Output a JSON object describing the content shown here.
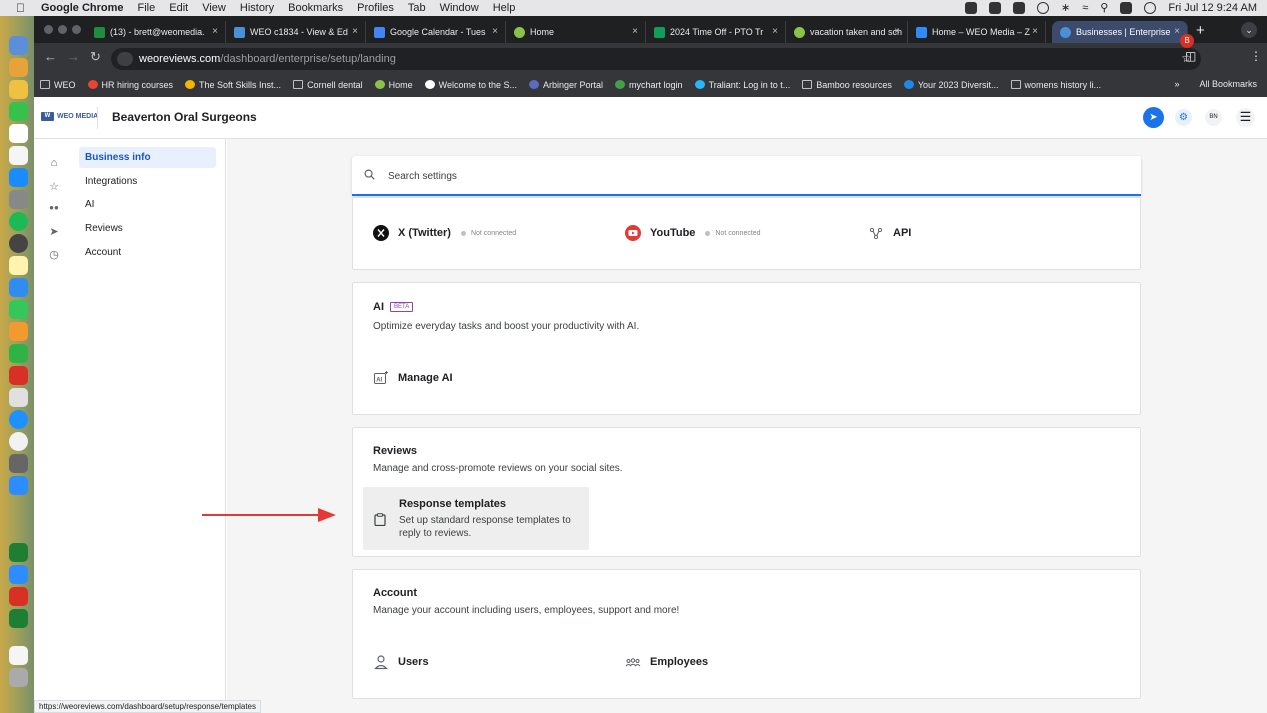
{
  "menubar": {
    "app": "Google Chrome",
    "items": [
      "File",
      "Edit",
      "View",
      "History",
      "Bookmarks",
      "Profiles",
      "Tab",
      "Window",
      "Help"
    ],
    "clock": "Fri Jul 12  9:24 AM"
  },
  "tabs": [
    {
      "label": "(13) - brett@weomedia.",
      "color": "#1e8e3e"
    },
    {
      "label": "WEO c1834 - View & Ed",
      "color": "#4a90d9"
    },
    {
      "label": "Google Calendar - Tues",
      "color": "#4285f4"
    },
    {
      "label": "Home",
      "color": "#8bc34a"
    },
    {
      "label": "2024 Time Off - PTO Tr",
      "color": "#0f9d58"
    },
    {
      "label": "vacation taken and sch",
      "color": "#8bc34a"
    },
    {
      "label": "Home – WEO Media – Z",
      "color": "#2d8cff"
    },
    {
      "label": "Businesses | Enterprise",
      "color": "#4a90d9"
    }
  ],
  "omnibox": {
    "host": "weoreviews.com",
    "path": "/dashboard/enterprise/setup/landing"
  },
  "profile_initial": "B",
  "bookmarks": [
    {
      "label": "WEO",
      "type": "folder"
    },
    {
      "label": "HR hiring courses",
      "type": "site",
      "color": "#ea4335"
    },
    {
      "label": "The Soft Skills Inst...",
      "type": "site",
      "color": "#f4b400"
    },
    {
      "label": "Cornell dental",
      "type": "folder"
    },
    {
      "label": "Home",
      "type": "site",
      "color": "#8bc34a"
    },
    {
      "label": "Welcome to the S...",
      "type": "site",
      "color": "#ffffff"
    },
    {
      "label": "Arbinger Portal",
      "type": "site",
      "color": "#5c6bc0"
    },
    {
      "label": "mychart login",
      "type": "site",
      "color": "#43a047"
    },
    {
      "label": "Traliant: Log in to t...",
      "type": "site",
      "color": "#29b6f6"
    },
    {
      "label": "Bamboo resources",
      "type": "folder"
    },
    {
      "label": "Your 2023 Diversit...",
      "type": "site",
      "color": "#1e88e5"
    },
    {
      "label": "womens history li...",
      "type": "folder"
    }
  ],
  "bookmarks_overflow": "»",
  "bookmarks_all": "All Bookmarks",
  "app": {
    "logo_text": "WEO MEDIA",
    "business_name": "Beaverton Oral Surgeons",
    "user_initials": "BN"
  },
  "sidenav": {
    "items": [
      "Business info",
      "Integrations",
      "AI",
      "Reviews",
      "Account"
    ]
  },
  "search": {
    "placeholder": "Search settings"
  },
  "social": {
    "twitter": {
      "label": "X (Twitter)",
      "status": "Not connected"
    },
    "youtube": {
      "label": "YouTube",
      "status": "Not connected"
    },
    "api": {
      "label": "API"
    }
  },
  "ai_card": {
    "title": "AI",
    "badge": "BETA",
    "desc": "Optimize everyday tasks and boost your productivity with AI.",
    "item": "Manage AI"
  },
  "reviews_card": {
    "title": "Reviews",
    "desc": "Manage and cross-promote reviews on your social sites.",
    "item_title": "Response templates",
    "item_desc": "Set up standard response templates to reply to reviews."
  },
  "account_card": {
    "title": "Account",
    "desc": "Manage your account including users, employees, support and more!",
    "users": "Users",
    "employees": "Employees"
  },
  "status_url": "https://weoreviews.com/dashboard/setup/response/templates",
  "colors": {
    "accent": "#1a73e8",
    "beta": "#8e44ad",
    "arrow": "#e53935",
    "youtube": "#e53935"
  }
}
